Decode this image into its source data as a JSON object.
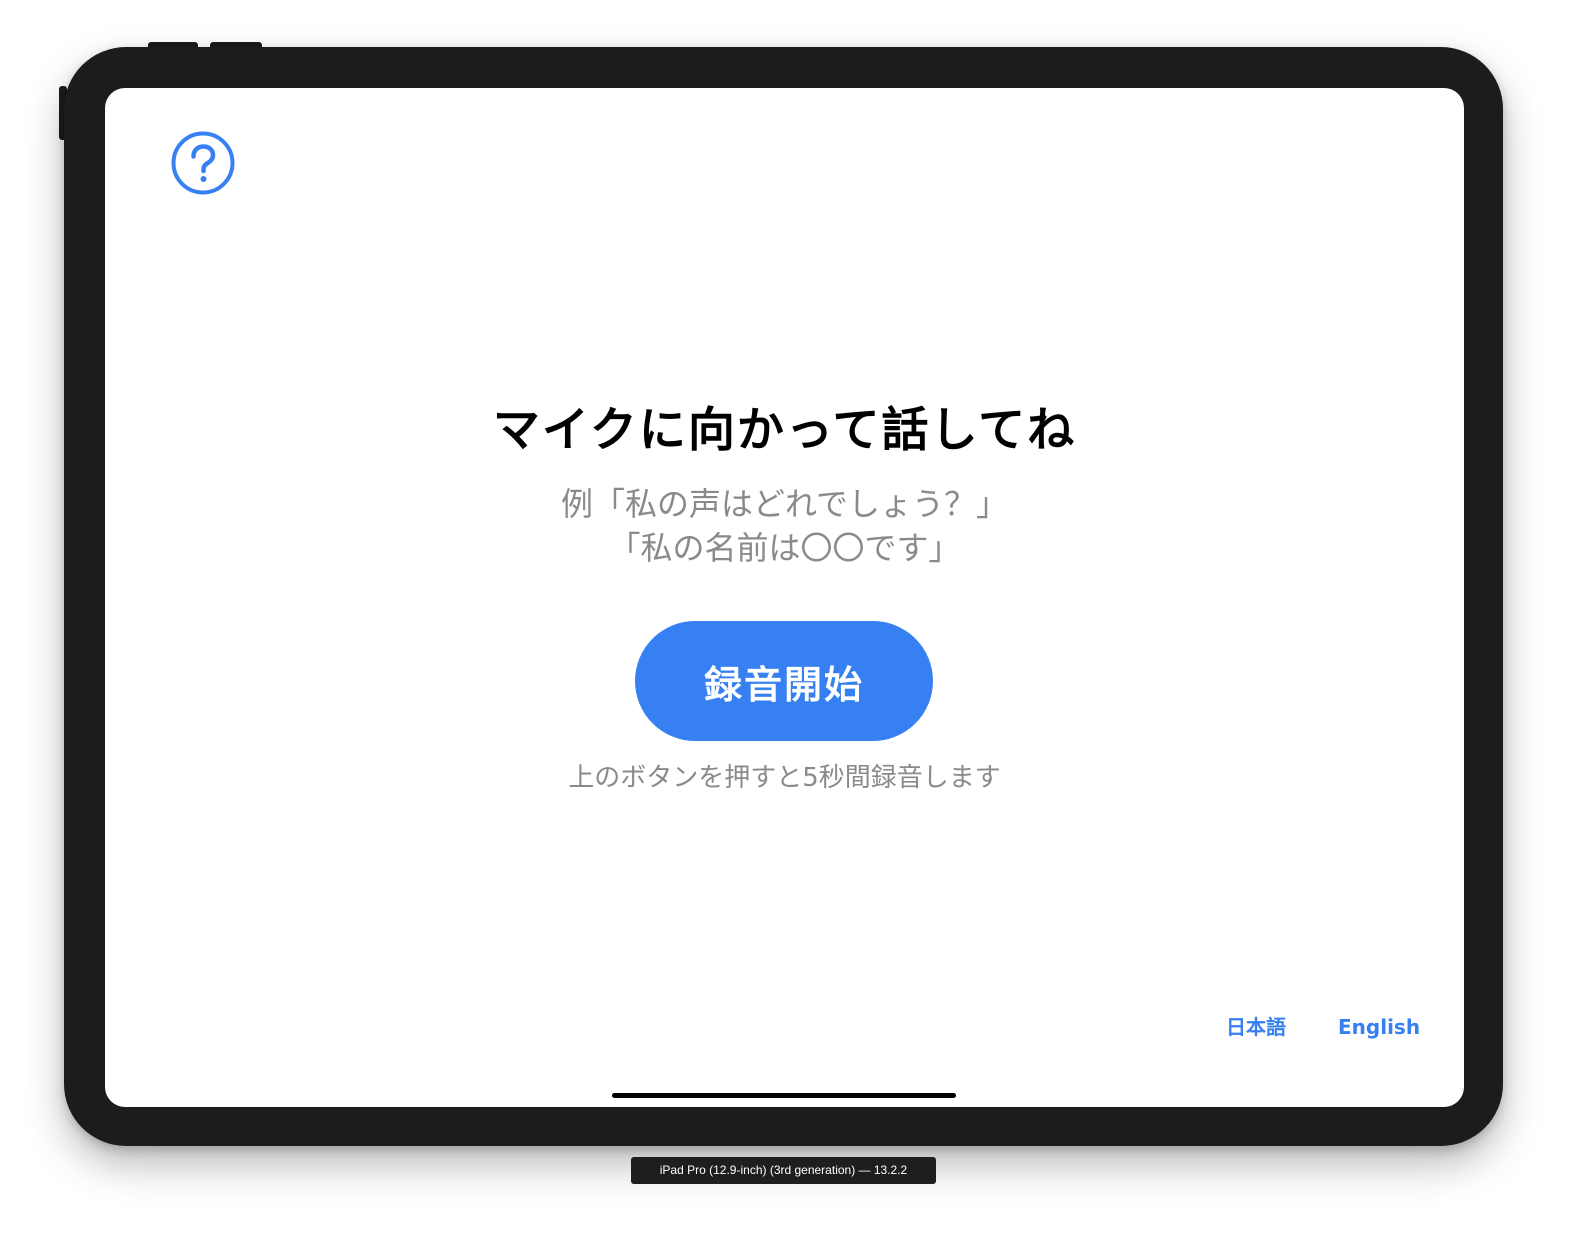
{
  "simulator": {
    "device_label": "iPad Pro (12.9-inch) (3rd generation) — 13.2.2"
  },
  "app": {
    "help_icon": "question-circle-icon",
    "title": "マイクに向かって話してね",
    "example_line1": "例「私の声はどれでしょう？」",
    "example_line2": "「私の名前は〇〇です」",
    "record_button_label": "録音開始",
    "hint": "上のボタンを押すと5秒間録音します",
    "languages": [
      {
        "label": "日本語"
      },
      {
        "label": "English"
      }
    ]
  },
  "colors": {
    "accent": "#3680f2",
    "secondary_text": "#8a8a8a",
    "bezel": "#1c1c1c"
  }
}
